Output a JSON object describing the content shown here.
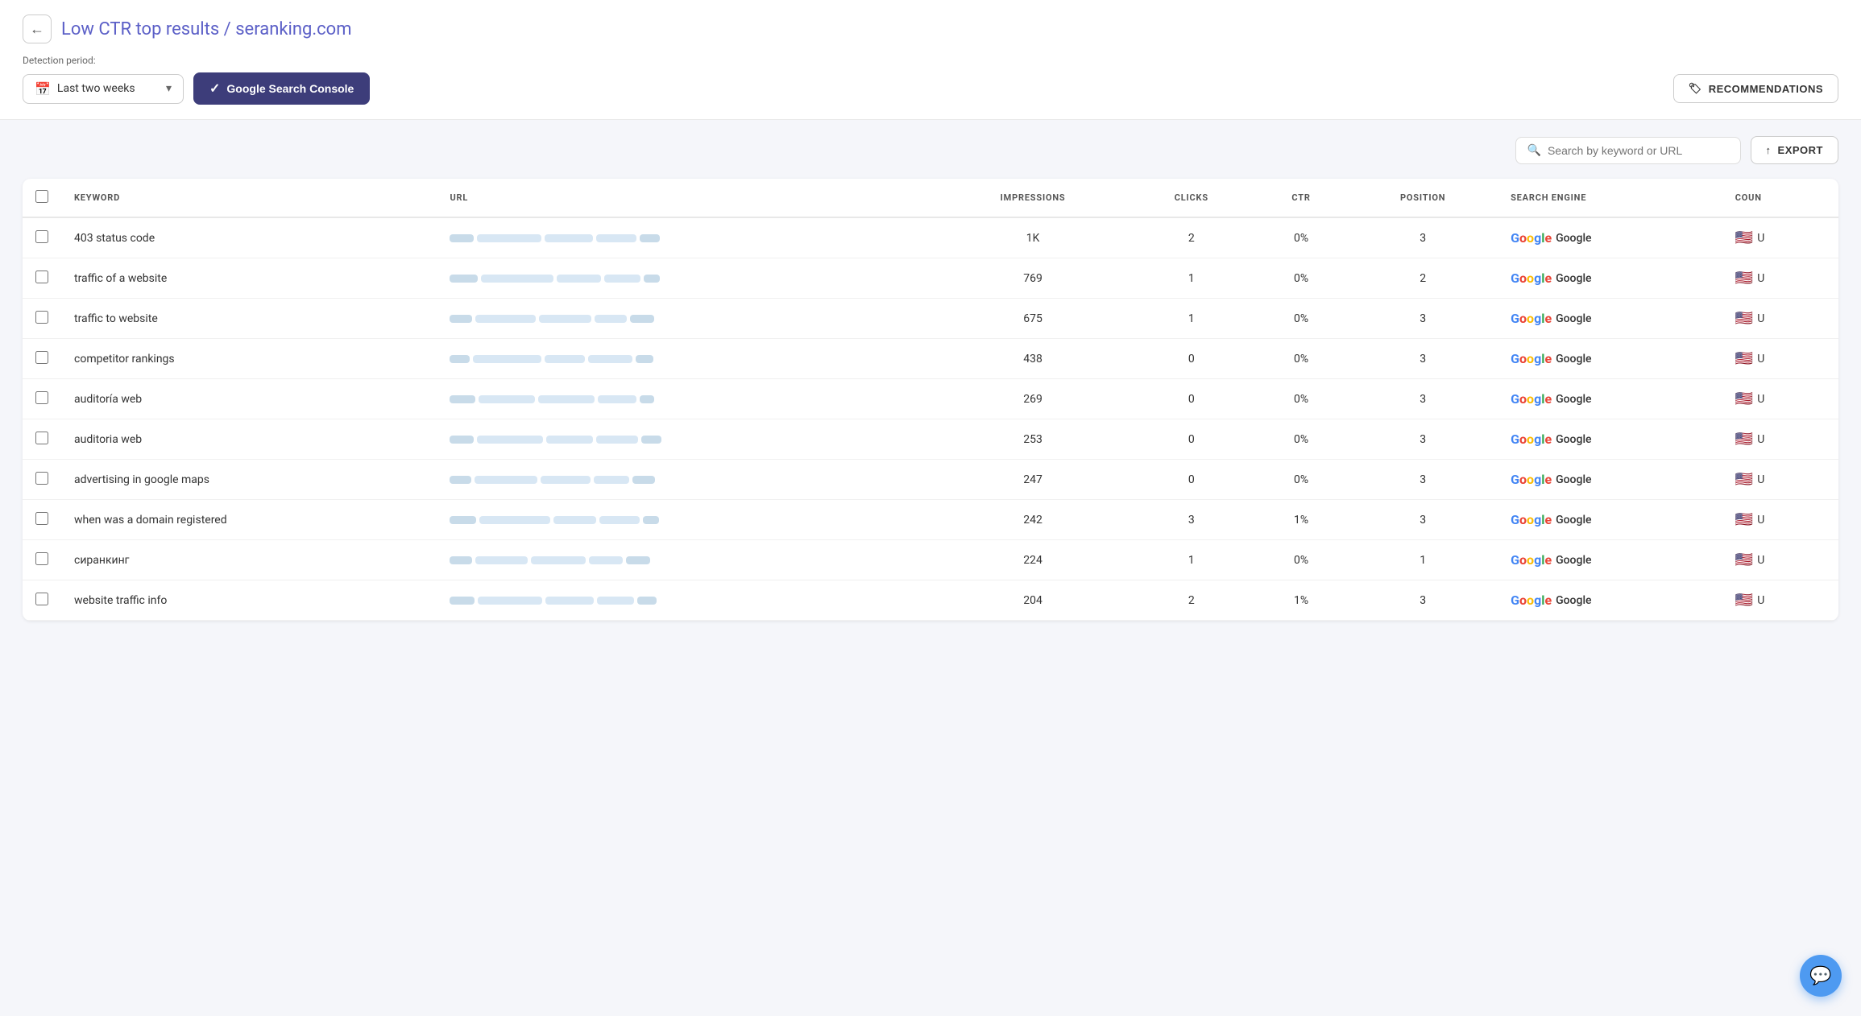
{
  "header": {
    "back_label": "←",
    "title": "Low CTR top results",
    "site": "/ seranking.com",
    "detection_period_label": "Detection period:",
    "period_value": "Last two weeks",
    "gsc_button": "Google Search Console",
    "recommendations_button": "RECOMMENDATIONS"
  },
  "toolbar": {
    "search_placeholder": "Search by keyword or URL",
    "export_button": "EXPORT"
  },
  "table": {
    "columns": [
      "KEYWORD",
      "URL",
      "IMPRESSIONS",
      "CLICKS",
      "CTR",
      "POSITION",
      "SEARCH ENGINE",
      "COUN"
    ],
    "rows": [
      {
        "keyword": "403 status code",
        "impressions": "1K",
        "clicks": "2",
        "ctr": "0%",
        "position": "3",
        "engine": "Google",
        "country": "U"
      },
      {
        "keyword": "traffic of a website",
        "impressions": "769",
        "clicks": "1",
        "ctr": "0%",
        "position": "2",
        "engine": "Google",
        "country": "U"
      },
      {
        "keyword": "traffic to website",
        "impressions": "675",
        "clicks": "1",
        "ctr": "0%",
        "position": "3",
        "engine": "Google",
        "country": "U"
      },
      {
        "keyword": "competitor rankings",
        "impressions": "438",
        "clicks": "0",
        "ctr": "0%",
        "position": "3",
        "engine": "Google",
        "country": "U"
      },
      {
        "keyword": "auditoría web",
        "impressions": "269",
        "clicks": "0",
        "ctr": "0%",
        "position": "3",
        "engine": "Google",
        "country": "U"
      },
      {
        "keyword": "auditoria web",
        "impressions": "253",
        "clicks": "0",
        "ctr": "0%",
        "position": "3",
        "engine": "Google",
        "country": "U"
      },
      {
        "keyword": "advertising in google maps",
        "impressions": "247",
        "clicks": "0",
        "ctr": "0%",
        "position": "3",
        "engine": "Google",
        "country": "U"
      },
      {
        "keyword": "when was a domain registered",
        "impressions": "242",
        "clicks": "3",
        "ctr": "1%",
        "position": "3",
        "engine": "Google",
        "country": "U"
      },
      {
        "keyword": "сиранкинг",
        "impressions": "224",
        "clicks": "1",
        "ctr": "0%",
        "position": "1",
        "engine": "Google",
        "country": "U"
      },
      {
        "keyword": "website traffic info",
        "impressions": "204",
        "clicks": "2",
        "ctr": "1%",
        "position": "3",
        "engine": "Google",
        "country": "U"
      }
    ]
  }
}
